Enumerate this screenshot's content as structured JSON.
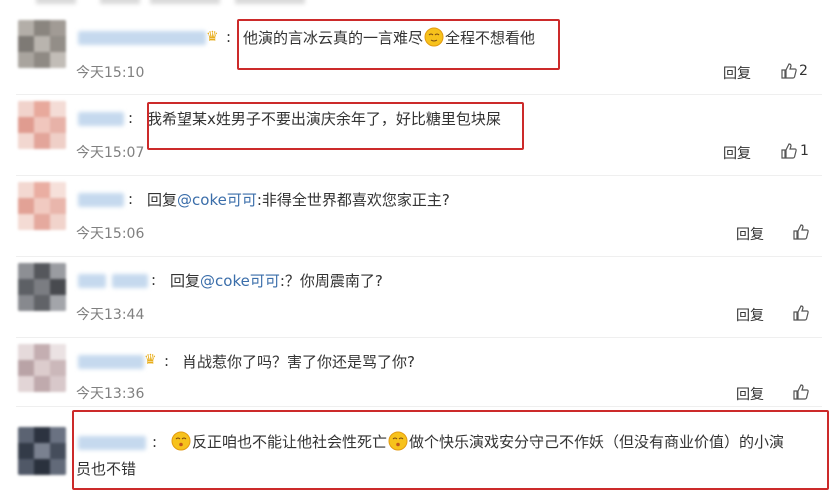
{
  "comments": [
    {
      "text_before": "他演的言冰云真的一言难尽",
      "text_after": "全程不想看他",
      "time": "今天15:10",
      "reply_label": "回复",
      "likes": "2",
      "has_crown": true
    },
    {
      "text": "我希望某x姓男子不要出演庆余年了，好比糖里包块屎",
      "time": "今天15:07",
      "reply_label": "回复",
      "likes": "1"
    },
    {
      "prefix": "回复",
      "mention": "@coke可可",
      "text": ":非得全世界都喜欢您家正主?",
      "time": "今天15:06",
      "reply_label": "回复"
    },
    {
      "prefix": "回复",
      "mention": "@coke可可",
      "text": ":？你周震南了?",
      "time": "今天13:44",
      "reply_label": "回复"
    },
    {
      "text": "肖战惹你了吗？害了你还是骂了你?",
      "time": "今天13:36",
      "reply_label": "回复",
      "has_crown": true
    },
    {
      "text_part1": "反正咱也不能让他社会性死亡",
      "text_part2": "做个快乐演戏安分守己不作妖（但没有商业价值）的小演",
      "text_line2": "员也不错"
    }
  ],
  "icons": {
    "like": "thumbs-up-icon",
    "crown": "crown-icon",
    "emoji": "face-emoji-icon"
  },
  "colors": {
    "highlight_box": "#cc2a2a",
    "mention": "#3b6eaa",
    "time": "#808080"
  }
}
